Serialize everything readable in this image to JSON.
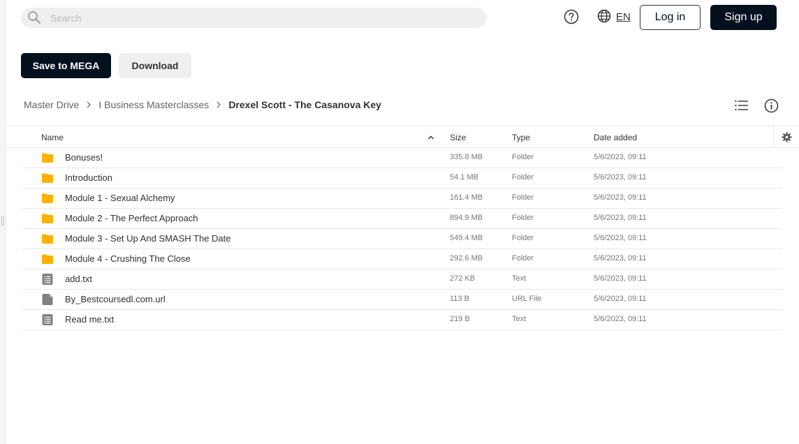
{
  "topbar": {
    "search_placeholder": "Search",
    "language": "EN",
    "login_label": "Log in",
    "signup_label": "Sign up"
  },
  "actions": {
    "save_label": "Save to MEGA",
    "download_label": "Download"
  },
  "breadcrumb": {
    "items": [
      "Master Drive",
      "I Business Masterclasses"
    ],
    "current": "Drexel Scott - The Casanova Key"
  },
  "table": {
    "columns": {
      "name": "Name",
      "size": "Size",
      "type": "Type",
      "date": "Date added"
    },
    "rows": [
      {
        "icon": "folder-icon",
        "name": "Bonuses!",
        "size": "335.8 MB",
        "type": "Folder",
        "date": "5/6/2023, 09:11"
      },
      {
        "icon": "folder-icon",
        "name": "Introduction",
        "size": "54.1 MB",
        "type": "Folder",
        "date": "5/6/2023, 09:11"
      },
      {
        "icon": "folder-icon",
        "name": "Module 1 - Sexual Alchemy",
        "size": "161.4 MB",
        "type": "Folder",
        "date": "5/6/2023, 09:11"
      },
      {
        "icon": "folder-icon",
        "name": "Module 2 - The Perfect Approach",
        "size": "894.9 MB",
        "type": "Folder",
        "date": "5/6/2023, 09:11"
      },
      {
        "icon": "folder-icon",
        "name": "Module 3 - Set Up And SMASH The Date",
        "size": "549.4 MB",
        "type": "Folder",
        "date": "5/6/2023, 09:11"
      },
      {
        "icon": "folder-icon",
        "name": "Module 4 - Crushing The Close",
        "size": "292.6 MB",
        "type": "Folder",
        "date": "5/6/2023, 09:11"
      },
      {
        "icon": "text-file-icon",
        "name": "add.txt",
        "size": "272 KB",
        "type": "Text",
        "date": "5/6/2023, 09:11"
      },
      {
        "icon": "generic-file-icon",
        "name": "By_Bestcoursedl.com.url",
        "size": "113 B",
        "type": "URL File",
        "date": "5/6/2023, 09:11"
      },
      {
        "icon": "text-file-icon",
        "name": "Read me.txt",
        "size": "219 B",
        "type": "Text",
        "date": "5/6/2023, 09:11"
      }
    ]
  },
  "colors": {
    "primary_dark": "#04101e",
    "folder": "#ffb300",
    "file_grey": "#808080",
    "divider": "#e8e8e8"
  }
}
